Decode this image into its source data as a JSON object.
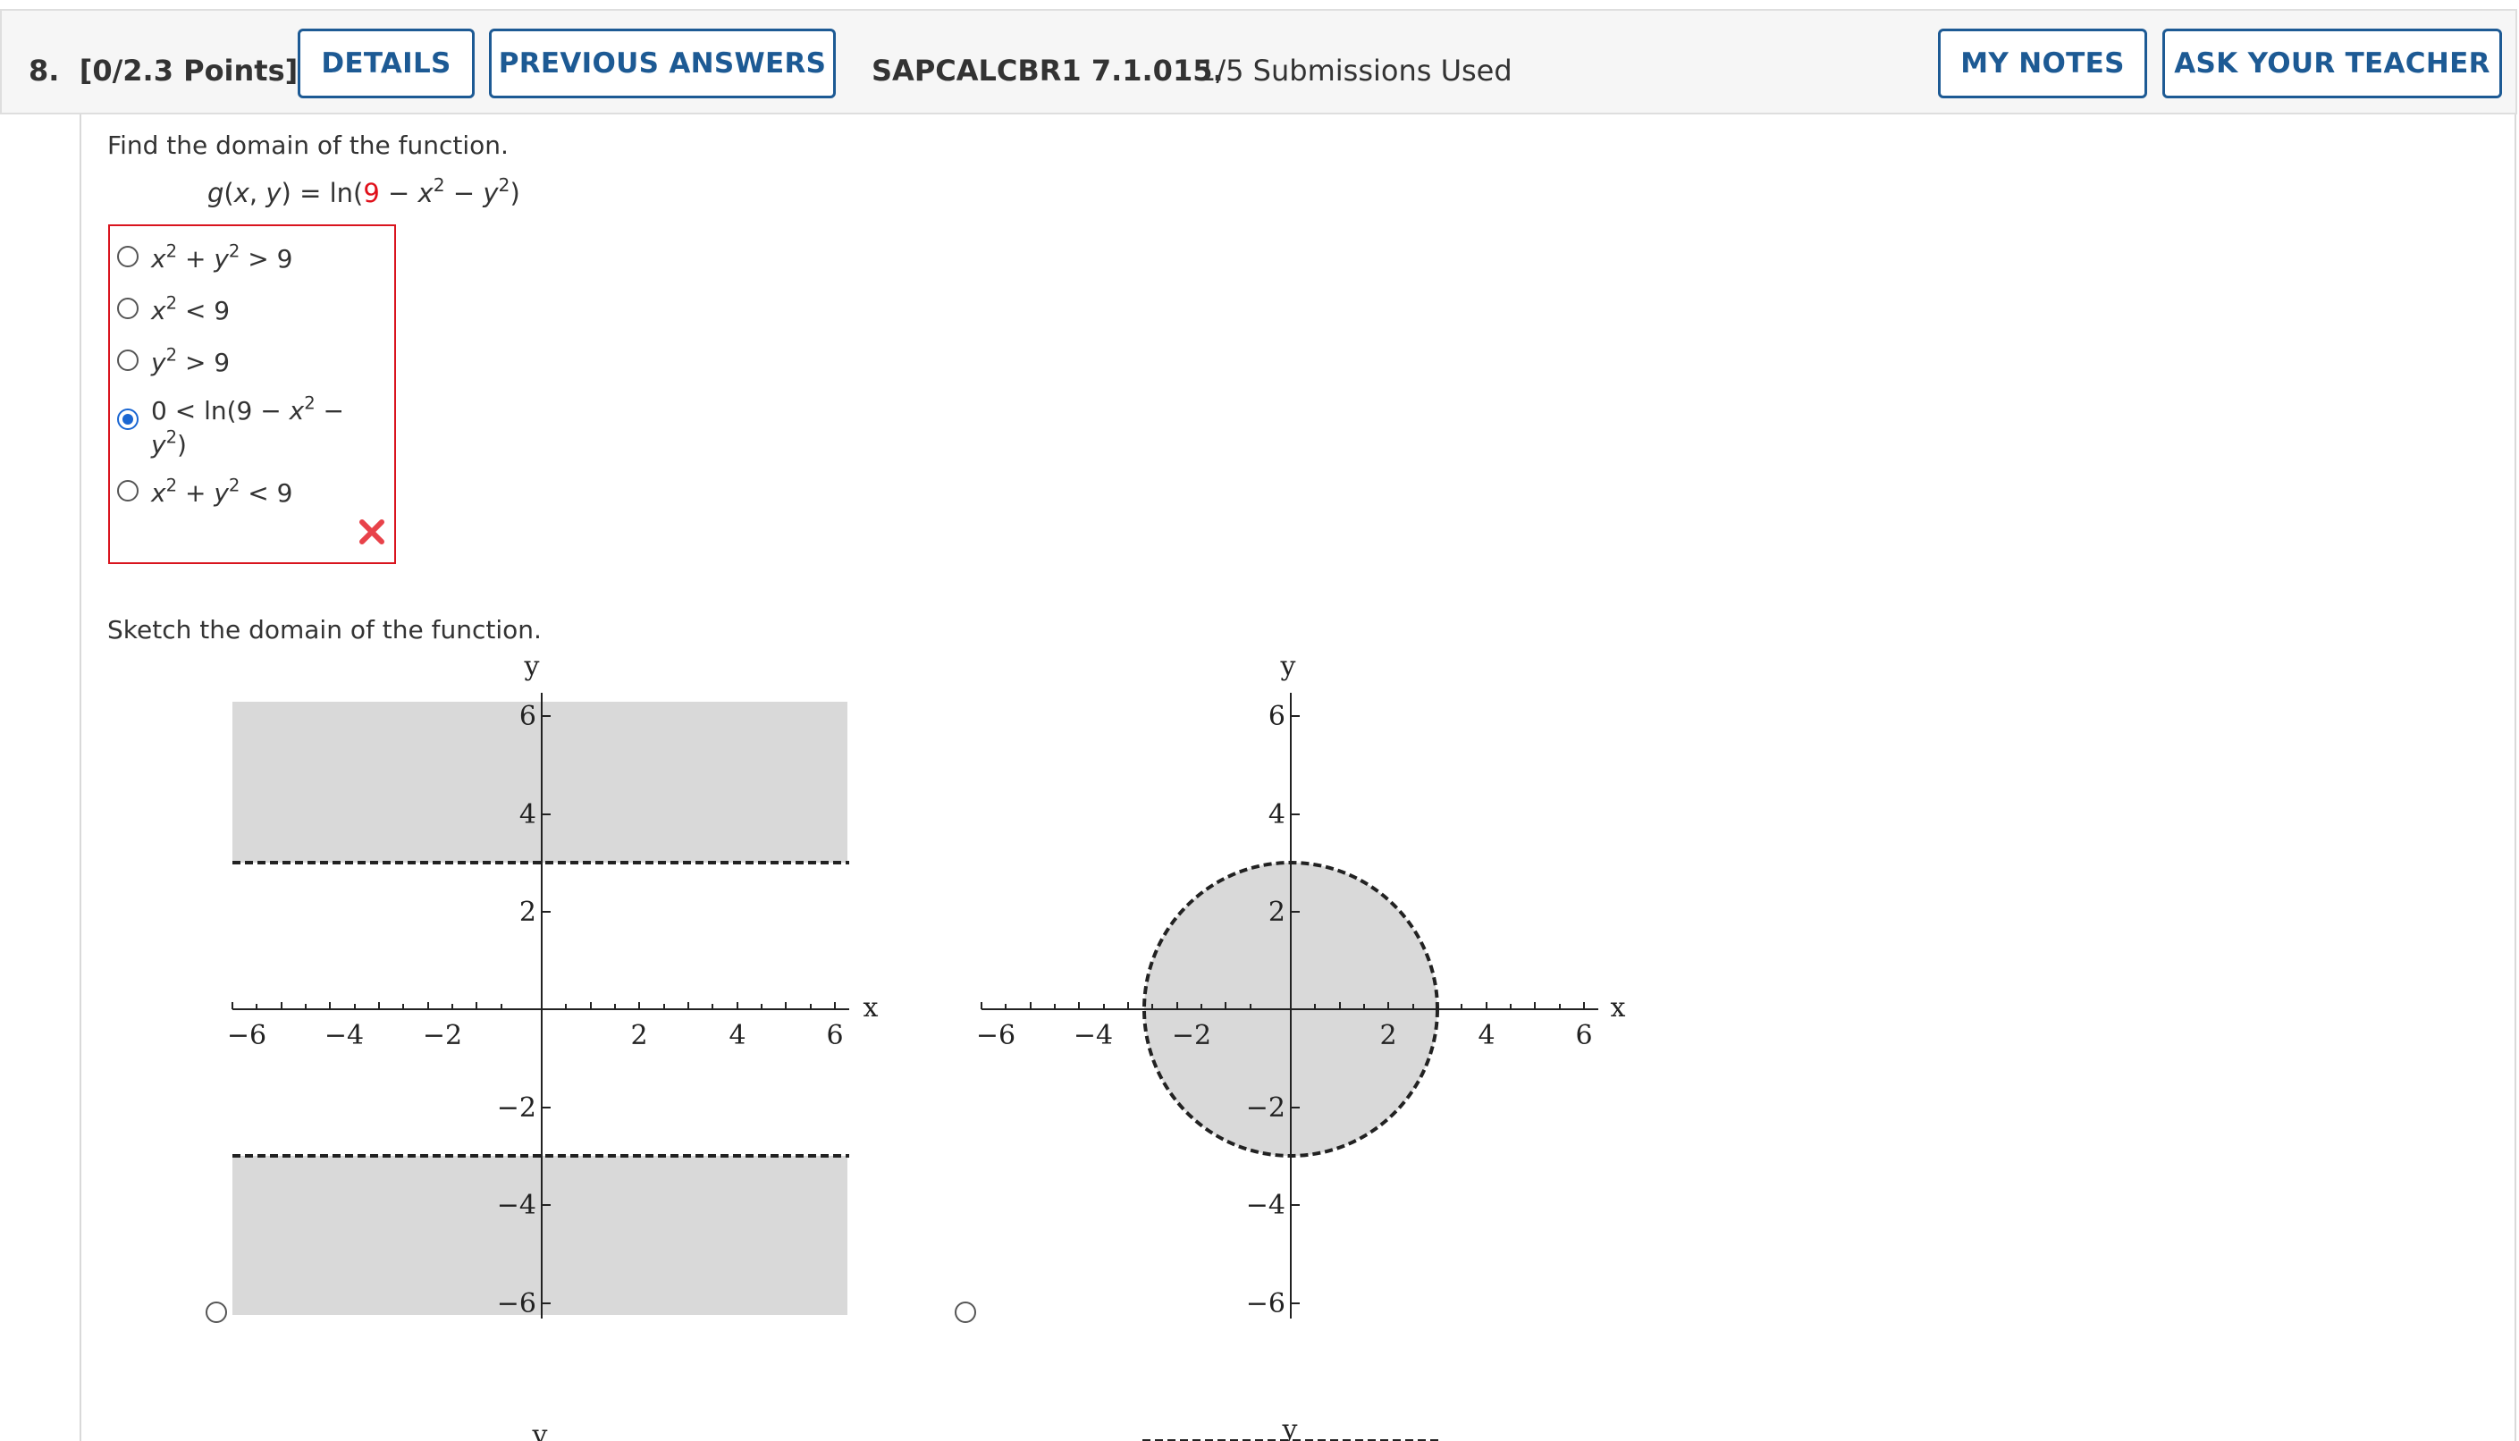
{
  "header": {
    "question_number": "8.",
    "points": "[0/2.3 Points]",
    "details_label": "DETAILS",
    "previous_answers_label": "PREVIOUS ANSWERS",
    "problem_code": "SAPCALCBR1 7.1.015.",
    "submissions": "1/5 Submissions Used",
    "my_notes_label": "MY NOTES",
    "ask_teacher_label": "ASK YOUR TEACHER"
  },
  "part1": {
    "prompt": "Find the domain of the function.",
    "function": "g(x, y) = ln(9 − x2 − y2)",
    "choices": [
      "x2 + y2 > 9",
      "x2 < 9",
      "y2 > 9",
      "0 < ln(9 − x2 − y2)",
      "x2 + y2 < 9"
    ],
    "selected_index": 3,
    "status": "incorrect"
  },
  "part2": {
    "prompt": "Sketch the domain of the function.",
    "graphs": [
      {
        "shading": "|y| > 3",
        "boundary": "dashed horizontal lines y = 3 and y = -3"
      },
      {
        "shading": "x^2 + y^2 < 9",
        "boundary": "dashed circle radius 3"
      }
    ],
    "axis_label_x": "x",
    "axis_label_y": "y",
    "x_ticks": [
      "−6",
      "−4",
      "−2",
      "2",
      "4",
      "6"
    ],
    "y_ticks": [
      "6",
      "4",
      "2",
      "−2",
      "−4",
      "−6"
    ]
  },
  "colors": {
    "accent": "#1d5a94",
    "error": "#d9141e",
    "selected_radio": "#1a66d2",
    "shade": "#d9d9d9"
  }
}
